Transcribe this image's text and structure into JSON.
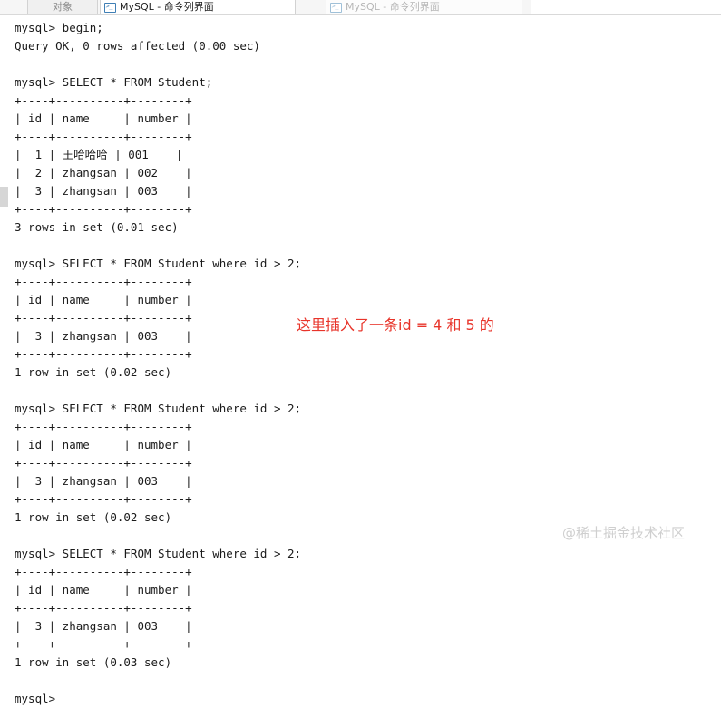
{
  "window": {
    "tabs": [
      {
        "label": "对象",
        "active": false,
        "icon": null
      },
      {
        "label": "MySQL - 命令列界面",
        "active": true,
        "icon": "mysql-console-icon"
      },
      {
        "label": "MySQL - 命令列界面",
        "active": false,
        "icon": "mysql-console-icon"
      }
    ]
  },
  "terminal": {
    "content": "mysql> begin;\nQuery OK, 0 rows affected (0.00 sec)\n\nmysql> SELECT * FROM Student;\n+----+----------+--------+\n| id | name     | number |\n+----+----------+--------+\n|  1 | 王哈哈哈 | 001    |\n|  2 | zhangsan | 002    |\n|  3 | zhangsan | 003    |\n+----+----------+--------+\n3 rows in set (0.01 sec)\n\nmysql> SELECT * FROM Student where id > 2;\n+----+----------+--------+\n| id | name     | number |\n+----+----------+--------+\n|  3 | zhangsan | 003    |\n+----+----------+--------+\n1 row in set (0.02 sec)\n\nmysql> SELECT * FROM Student where id > 2;\n+----+----------+--------+\n| id | name     | number |\n+----+----------+--------+\n|  3 | zhangsan | 003    |\n+----+----------+--------+\n1 row in set (0.02 sec)\n\nmysql> SELECT * FROM Student where id > 2;\n+----+----------+--------+\n| id | name     | number |\n+----+----------+--------+\n|  3 | zhangsan | 003    |\n+----+----------+--------+\n1 row in set (0.03 sec)\n\nmysql>",
    "prompt": "mysql>",
    "text_color": "#1a1a1a",
    "background": "#ffffff"
  },
  "annotation": {
    "text": "这里插入了一条id = 4 和 5 的",
    "color": "#e8342a"
  },
  "watermark": {
    "text": "@稀土掘金技术社区",
    "color": "#cfcfcf"
  },
  "scrollbar": {
    "thumb_color": "#d6d6d6"
  }
}
